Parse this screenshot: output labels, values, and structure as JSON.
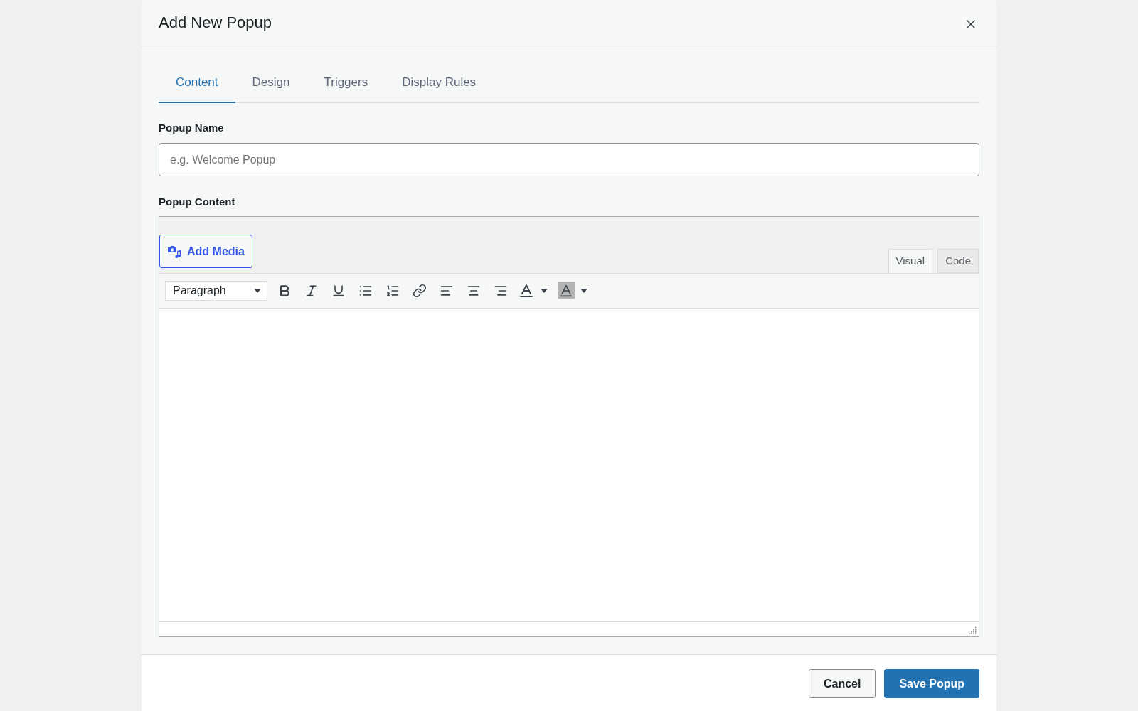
{
  "dialog": {
    "title": "Add New Popup"
  },
  "tabs": [
    {
      "label": "Content",
      "selected": true
    },
    {
      "label": "Design",
      "selected": false
    },
    {
      "label": "Triggers",
      "selected": false
    },
    {
      "label": "Display Rules",
      "selected": false
    }
  ],
  "name_field": {
    "label": "Popup Name",
    "placeholder": "e.g. Welcome Popup"
  },
  "content_editor": {
    "label": "Popup Content",
    "add_media_button": "Add Media",
    "mode_tabs": [
      {
        "label": "Visual",
        "selected": true
      },
      {
        "label": "Code",
        "selected": false
      }
    ],
    "format_select": {
      "value": "Paragraph"
    }
  },
  "footer": {
    "buttons": [
      {
        "label": "Cancel",
        "kind": "secondary"
      },
      {
        "label": "Save Popup",
        "kind": "primary"
      }
    ]
  }
}
